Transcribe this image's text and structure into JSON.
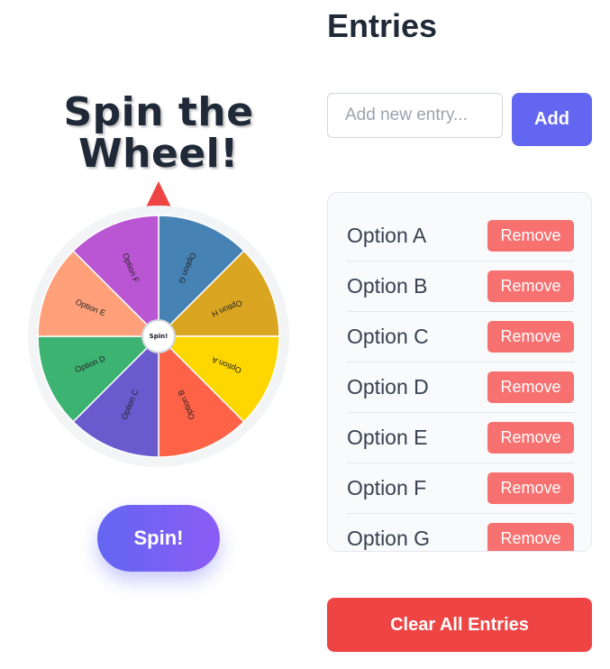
{
  "wheel": {
    "title_line1": "Spin the",
    "title_line2": "Wheel!",
    "center_label": "Spin!",
    "spin_button_label": "Spin!",
    "pointer_icon": "triangle-pointer",
    "segments": [
      {
        "label": "Option A",
        "color": "#FFD700"
      },
      {
        "label": "Option B",
        "color": "#FF6347"
      },
      {
        "label": "Option C",
        "color": "#6A5ACD"
      },
      {
        "label": "Option D",
        "color": "#3CB371"
      },
      {
        "label": "Option E",
        "color": "#FFA07A"
      },
      {
        "label": "Option F",
        "color": "#BA55D3"
      },
      {
        "label": "Option G",
        "color": "#4682B4"
      },
      {
        "label": "Option H",
        "color": "#DAA520"
      }
    ]
  },
  "entries": {
    "title": "Entries",
    "input_placeholder": "Add new entry...",
    "input_value": "",
    "add_button_label": "Add",
    "remove_label": "Remove",
    "items": [
      "Option A",
      "Option B",
      "Option C",
      "Option D",
      "Option E",
      "Option F",
      "Option G"
    ],
    "clear_button_label": "Clear All Entries"
  },
  "colors": {
    "accent": "#6366f1",
    "danger": "#ef4444",
    "remove": "#f87171",
    "text": "#1f2937"
  }
}
